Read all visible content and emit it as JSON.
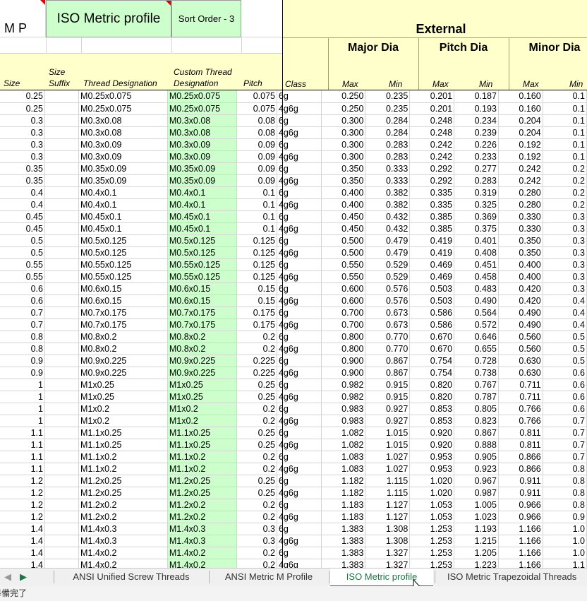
{
  "header": {
    "mp_label": "M P",
    "title": "ISO Metric profile",
    "sort_order": "Sort Order - 3",
    "external": "External",
    "major_dia": "Major Dia",
    "pitch_dia": "Pitch Dia",
    "minor_dia": "Minor Dia",
    "columns": {
      "size": "Size",
      "size_suffix_1": "Size",
      "size_suffix_2": "Suffix",
      "thread_designation": "Thread Designation",
      "custom_1": "Custom Thread",
      "custom_2": "Designation",
      "pitch": "Pitch",
      "class": "Class",
      "max": "Max",
      "min": "Min"
    }
  },
  "rows": [
    [
      "0.25",
      "",
      "M0.25x0.075",
      "M0.25x0.075",
      "0.075",
      "6g",
      "0.250",
      "0.235",
      "0.201",
      "0.187",
      "0.160",
      "0.1"
    ],
    [
      "0.25",
      "",
      "M0.25x0.075",
      "M0.25x0.075",
      "0.075",
      "4g6g",
      "0.250",
      "0.235",
      "0.201",
      "0.193",
      "0.160",
      "0.1"
    ],
    [
      "0.3",
      "",
      "M0.3x0.08",
      "M0.3x0.08",
      "0.08",
      "6g",
      "0.300",
      "0.284",
      "0.248",
      "0.234",
      "0.204",
      "0.1"
    ],
    [
      "0.3",
      "",
      "M0.3x0.08",
      "M0.3x0.08",
      "0.08",
      "4g6g",
      "0.300",
      "0.284",
      "0.248",
      "0.239",
      "0.204",
      "0.1"
    ],
    [
      "0.3",
      "",
      "M0.3x0.09",
      "M0.3x0.09",
      "0.09",
      "6g",
      "0.300",
      "0.283",
      "0.242",
      "0.226",
      "0.192",
      "0.1"
    ],
    [
      "0.3",
      "",
      "M0.3x0.09",
      "M0.3x0.09",
      "0.09",
      "4g6g",
      "0.300",
      "0.283",
      "0.242",
      "0.233",
      "0.192",
      "0.1"
    ],
    [
      "0.35",
      "",
      "M0.35x0.09",
      "M0.35x0.09",
      "0.09",
      "6g",
      "0.350",
      "0.333",
      "0.292",
      "0.277",
      "0.242",
      "0.2"
    ],
    [
      "0.35",
      "",
      "M0.35x0.09",
      "M0.35x0.09",
      "0.09",
      "4g6g",
      "0.350",
      "0.333",
      "0.292",
      "0.283",
      "0.242",
      "0.2"
    ],
    [
      "0.4",
      "",
      "M0.4x0.1",
      "M0.4x0.1",
      "0.1",
      "6g",
      "0.400",
      "0.382",
      "0.335",
      "0.319",
      "0.280",
      "0.2"
    ],
    [
      "0.4",
      "",
      "M0.4x0.1",
      "M0.4x0.1",
      "0.1",
      "4g6g",
      "0.400",
      "0.382",
      "0.335",
      "0.325",
      "0.280",
      "0.2"
    ],
    [
      "0.45",
      "",
      "M0.45x0.1",
      "M0.45x0.1",
      "0.1",
      "6g",
      "0.450",
      "0.432",
      "0.385",
      "0.369",
      "0.330",
      "0.3"
    ],
    [
      "0.45",
      "",
      "M0.45x0.1",
      "M0.45x0.1",
      "0.1",
      "4g6g",
      "0.450",
      "0.432",
      "0.385",
      "0.375",
      "0.330",
      "0.3"
    ],
    [
      "0.5",
      "",
      "M0.5x0.125",
      "M0.5x0.125",
      "0.125",
      "6g",
      "0.500",
      "0.479",
      "0.419",
      "0.401",
      "0.350",
      "0.3"
    ],
    [
      "0.5",
      "",
      "M0.5x0.125",
      "M0.5x0.125",
      "0.125",
      "4g6g",
      "0.500",
      "0.479",
      "0.419",
      "0.408",
      "0.350",
      "0.3"
    ],
    [
      "0.55",
      "",
      "M0.55x0.125",
      "M0.55x0.125",
      "0.125",
      "6g",
      "0.550",
      "0.529",
      "0.469",
      "0.451",
      "0.400",
      "0.3"
    ],
    [
      "0.55",
      "",
      "M0.55x0.125",
      "M0.55x0.125",
      "0.125",
      "4g6g",
      "0.550",
      "0.529",
      "0.469",
      "0.458",
      "0.400",
      "0.3"
    ],
    [
      "0.6",
      "",
      "M0.6x0.15",
      "M0.6x0.15",
      "0.15",
      "6g",
      "0.600",
      "0.576",
      "0.503",
      "0.483",
      "0.420",
      "0.3"
    ],
    [
      "0.6",
      "",
      "M0.6x0.15",
      "M0.6x0.15",
      "0.15",
      "4g6g",
      "0.600",
      "0.576",
      "0.503",
      "0.490",
      "0.420",
      "0.4"
    ],
    [
      "0.7",
      "",
      "M0.7x0.175",
      "M0.7x0.175",
      "0.175",
      "6g",
      "0.700",
      "0.673",
      "0.586",
      "0.564",
      "0.490",
      "0.4"
    ],
    [
      "0.7",
      "",
      "M0.7x0.175",
      "M0.7x0.175",
      "0.175",
      "4g6g",
      "0.700",
      "0.673",
      "0.586",
      "0.572",
      "0.490",
      "0.4"
    ],
    [
      "0.8",
      "",
      "M0.8x0.2",
      "M0.8x0.2",
      "0.2",
      "6g",
      "0.800",
      "0.770",
      "0.670",
      "0.646",
      "0.560",
      "0.5"
    ],
    [
      "0.8",
      "",
      "M0.8x0.2",
      "M0.8x0.2",
      "0.2",
      "4g6g",
      "0.800",
      "0.770",
      "0.670",
      "0.655",
      "0.560",
      "0.5"
    ],
    [
      "0.9",
      "",
      "M0.9x0.225",
      "M0.9x0.225",
      "0.225",
      "6g",
      "0.900",
      "0.867",
      "0.754",
      "0.728",
      "0.630",
      "0.5"
    ],
    [
      "0.9",
      "",
      "M0.9x0.225",
      "M0.9x0.225",
      "0.225",
      "4g6g",
      "0.900",
      "0.867",
      "0.754",
      "0.738",
      "0.630",
      "0.6"
    ],
    [
      "1",
      "",
      "M1x0.25",
      "M1x0.25",
      "0.25",
      "6g",
      "0.982",
      "0.915",
      "0.820",
      "0.767",
      "0.711",
      "0.6"
    ],
    [
      "1",
      "",
      "M1x0.25",
      "M1x0.25",
      "0.25",
      "4g6g",
      "0.982",
      "0.915",
      "0.820",
      "0.787",
      "0.711",
      "0.6"
    ],
    [
      "1",
      "",
      "M1x0.2",
      "M1x0.2",
      "0.2",
      "6g",
      "0.983",
      "0.927",
      "0.853",
      "0.805",
      "0.766",
      "0.6"
    ],
    [
      "1",
      "",
      "M1x0.2",
      "M1x0.2",
      "0.2",
      "4g6g",
      "0.983",
      "0.927",
      "0.853",
      "0.823",
      "0.766",
      "0.7"
    ],
    [
      "1.1",
      "",
      "M1.1x0.25",
      "M1.1x0.25",
      "0.25",
      "6g",
      "1.082",
      "1.015",
      "0.920",
      "0.867",
      "0.811",
      "0.7"
    ],
    [
      "1.1",
      "",
      "M1.1x0.25",
      "M1.1x0.25",
      "0.25",
      "4g6g",
      "1.082",
      "1.015",
      "0.920",
      "0.888",
      "0.811",
      "0.7"
    ],
    [
      "1.1",
      "",
      "M1.1x0.2",
      "M1.1x0.2",
      "0.2",
      "6g",
      "1.083",
      "1.027",
      "0.953",
      "0.905",
      "0.866",
      "0.7"
    ],
    [
      "1.1",
      "",
      "M1.1x0.2",
      "M1.1x0.2",
      "0.2",
      "4g6g",
      "1.083",
      "1.027",
      "0.953",
      "0.923",
      "0.866",
      "0.8"
    ],
    [
      "1.2",
      "",
      "M1.2x0.25",
      "M1.2x0.25",
      "0.25",
      "6g",
      "1.182",
      "1.115",
      "1.020",
      "0.967",
      "0.911",
      "0.8"
    ],
    [
      "1.2",
      "",
      "M1.2x0.25",
      "M1.2x0.25",
      "0.25",
      "4g6g",
      "1.182",
      "1.115",
      "1.020",
      "0.987",
      "0.911",
      "0.8"
    ],
    [
      "1.2",
      "",
      "M1.2x0.2",
      "M1.2x0.2",
      "0.2",
      "6g",
      "1.183",
      "1.127",
      "1.053",
      "1.005",
      "0.966",
      "0.8"
    ],
    [
      "1.2",
      "",
      "M1.2x0.2",
      "M1.2x0.2",
      "0.2",
      "4g6g",
      "1.183",
      "1.127",
      "1.053",
      "1.023",
      "0.966",
      "0.9"
    ],
    [
      "1.4",
      "",
      "M1.4x0.3",
      "M1.4x0.3",
      "0.3",
      "6g",
      "1.383",
      "1.308",
      "1.253",
      "1.193",
      "1.166",
      "1.0"
    ],
    [
      "1.4",
      "",
      "M1.4x0.3",
      "M1.4x0.3",
      "0.3",
      "4g6g",
      "1.383",
      "1.308",
      "1.253",
      "1.215",
      "1.166",
      "1.0"
    ],
    [
      "1.4",
      "",
      "M1.4x0.2",
      "M1.4x0.2",
      "0.2",
      "6g",
      "1.383",
      "1.327",
      "1.253",
      "1.205",
      "1.166",
      "1.0"
    ],
    [
      "1.4",
      "",
      "M1.4x0.2",
      "M1.4x0.2",
      "0.2",
      "4g6g",
      "1.383",
      "1.327",
      "1.253",
      "1.223",
      "1.166",
      "1.1"
    ]
  ],
  "tabs": {
    "tab1": "ANSI Unified Screw Threads",
    "tab2": "ANSI Metric M Profile",
    "tab3": "ISO Metric profile",
    "tab4": "ISO Metric Trapezoidal Threads"
  },
  "status": "準備完了",
  "colors": {
    "green": "#ccffcc",
    "yellow": "#ffffcc",
    "active_tab": "#217346"
  }
}
